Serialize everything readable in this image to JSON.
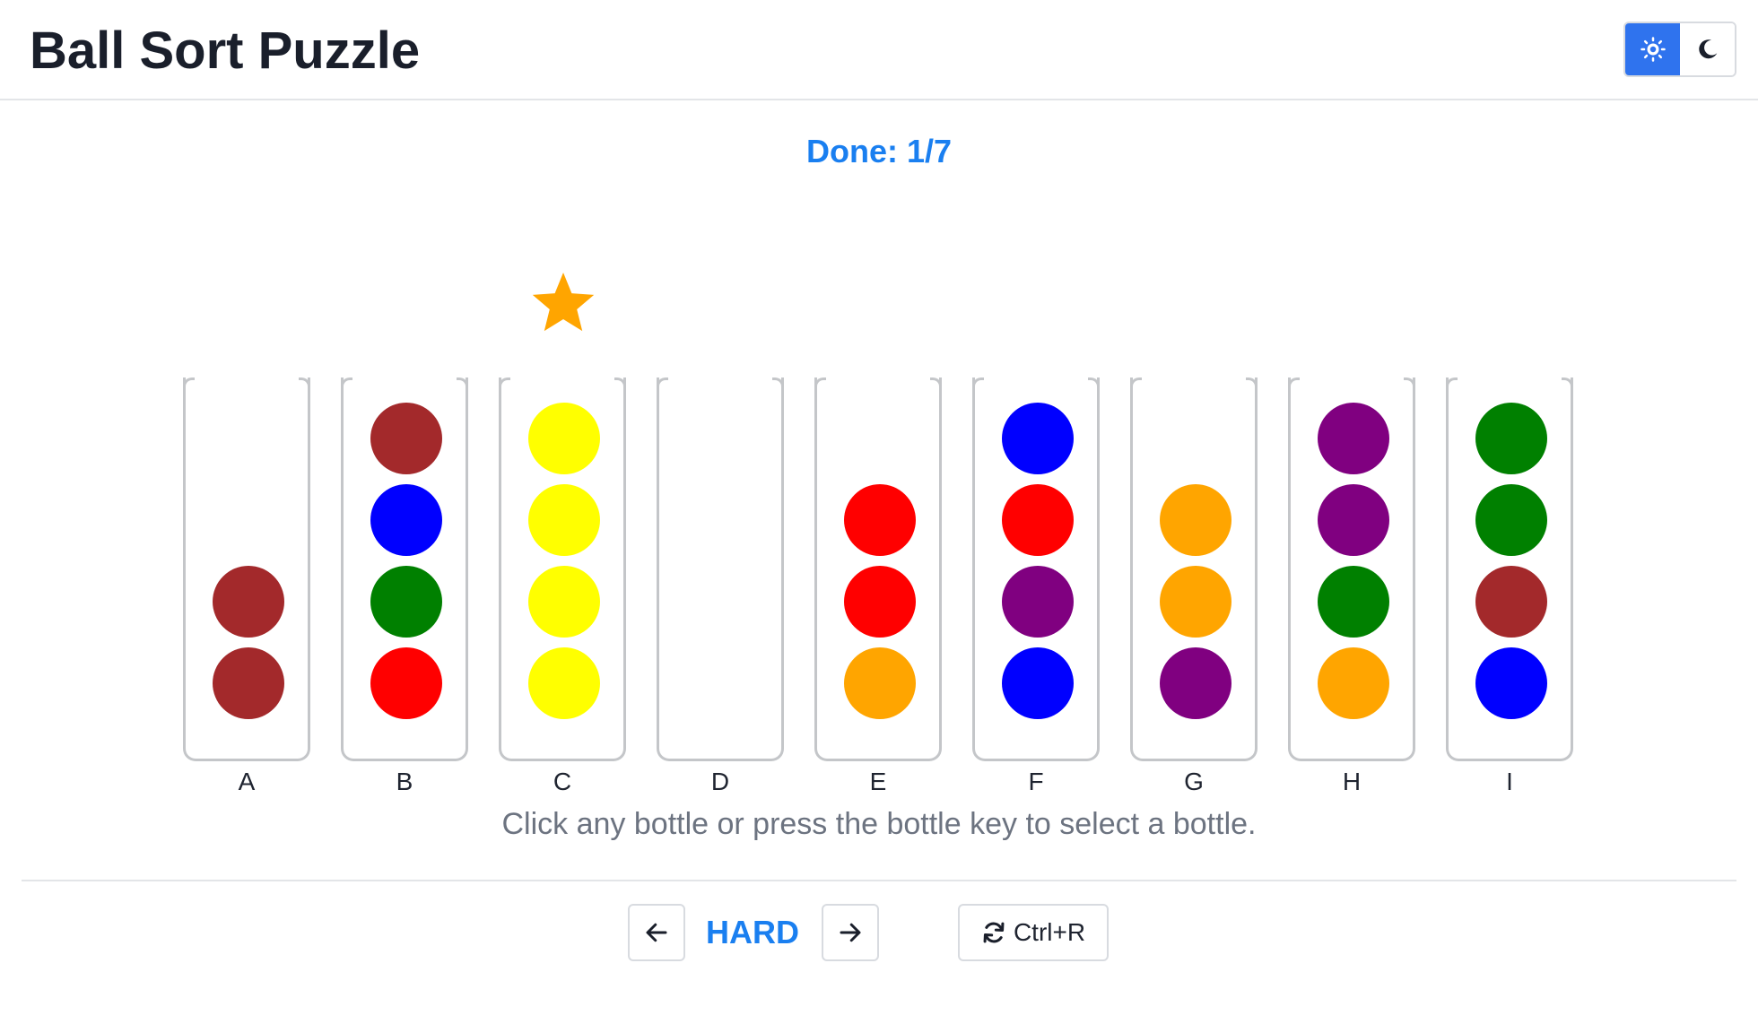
{
  "header": {
    "title": "Ball Sort Puzzle",
    "theme_light_icon": "sun-icon",
    "theme_dark_icon": "moon-icon",
    "active_theme": "light",
    "accent_color": "#2f73ee"
  },
  "status": {
    "text": "Done: 1/7"
  },
  "completed_marker": {
    "icon": "star-icon",
    "bottle": "C",
    "color": "#ffa500"
  },
  "bottles": [
    {
      "label": "A",
      "balls_top_to_bottom": [
        "brown",
        "brown"
      ]
    },
    {
      "label": "B",
      "balls_top_to_bottom": [
        "brown",
        "blue",
        "green",
        "red"
      ]
    },
    {
      "label": "C",
      "balls_top_to_bottom": [
        "yellow",
        "yellow",
        "yellow",
        "yellow"
      ]
    },
    {
      "label": "D",
      "balls_top_to_bottom": []
    },
    {
      "label": "E",
      "balls_top_to_bottom": [
        "red",
        "red",
        "orange"
      ]
    },
    {
      "label": "F",
      "balls_top_to_bottom": [
        "blue",
        "red",
        "purple",
        "blue"
      ]
    },
    {
      "label": "G",
      "balls_top_to_bottom": [
        "orange",
        "orange",
        "purple"
      ]
    },
    {
      "label": "H",
      "balls_top_to_bottom": [
        "purple",
        "purple",
        "green",
        "orange"
      ]
    },
    {
      "label": "I",
      "balls_top_to_bottom": [
        "green",
        "green",
        "brown",
        "blue"
      ]
    }
  ],
  "bottle_capacity": 4,
  "ball_colors": {
    "brown": "#a3292b",
    "blue": "#0000ff",
    "green": "#008000",
    "red": "#ff0000",
    "yellow": "#ffff00",
    "orange": "#ffa500",
    "purple": "#800080"
  },
  "hint": "Click any bottle or press the bottle key to select a bottle.",
  "controls": {
    "prev_icon": "arrow-left-icon",
    "difficulty": "HARD",
    "next_icon": "arrow-right-icon",
    "restart_icon": "refresh-icon",
    "restart_label": "Ctrl+R"
  }
}
